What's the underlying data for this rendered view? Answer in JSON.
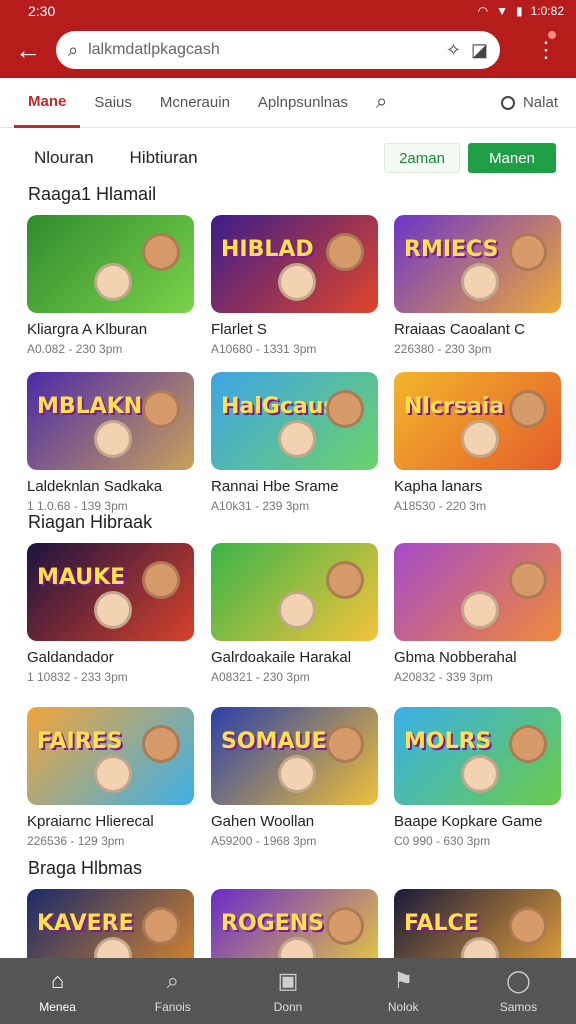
{
  "status": {
    "time": "2:30",
    "right": "1:0:82"
  },
  "search": {
    "value": "lalkmdatlpkagcash"
  },
  "tabs": [
    {
      "label": "Mane"
    },
    {
      "label": "Saius"
    },
    {
      "label": "Mcnerauin"
    },
    {
      "label": "Aplnpsunlnas"
    },
    {
      "label": "Nalat"
    }
  ],
  "filters": {
    "left1": "Nlouran",
    "left2": "Hibtiuran",
    "pill1": "2aman",
    "pill2": "Manen"
  },
  "sections": [
    {
      "title": "Raaga1 Hlamail"
    },
    {
      "title": "Riagan Hibraak"
    },
    {
      "title": "Braga Hlbmas"
    }
  ],
  "cards": [
    {
      "title": "Kliargra A Klburan",
      "meta": "A0.082 - 230 3pm",
      "colors": [
        "#2e8b2e",
        "#7bd34a"
      ]
    },
    {
      "title": "Flarlet S",
      "meta": "A10680 - 1331 3pm",
      "colors": [
        "#3a1d8a",
        "#e0452a"
      ]
    },
    {
      "title": "Rraiaas Caoalant C",
      "meta": "226380 - 230 3pm",
      "colors": [
        "#6a35c9",
        "#f0a93a"
      ]
    },
    {
      "title": "Laldeknlan Sadkaka",
      "meta": "1 1.0.68 - 139 3pm",
      "colors": [
        "#4b2aa8",
        "#c9a15c"
      ]
    },
    {
      "title": "Rannai Hbe Srame",
      "meta": "A10k31 - 239 3pm",
      "colors": [
        "#3fa4e6",
        "#6bd26a"
      ]
    },
    {
      "title": "Kapha lanars",
      "meta": "A18530 - 220 3m",
      "colors": [
        "#f2b52b",
        "#e55d2b"
      ]
    },
    {
      "title": "Galdandador",
      "meta": "1 10832 - 233 3pm",
      "colors": [
        "#1b1340",
        "#d9412a"
      ]
    },
    {
      "title": "Galrdoakaile Harakal",
      "meta": "A08321 - 230 3pm",
      "colors": [
        "#39b54a",
        "#f5c33a"
      ]
    },
    {
      "title": "Gbma Nobberahal",
      "meta": "A20832 - 339 3pm",
      "colors": [
        "#a54ac9",
        "#f08a3a"
      ]
    },
    {
      "title": "Kpraiarnc Hlierecal",
      "meta": "226536 - 129 3pm",
      "colors": [
        "#f2a43a",
        "#3db0e8"
      ]
    },
    {
      "title": "Gahen Woollan",
      "meta": "A59200 - 1968 3pm",
      "colors": [
        "#2a3fa8",
        "#f0c13a"
      ]
    },
    {
      "title": "Baape Kopkare Game",
      "meta": "C0 990 - 630 3pm",
      "colors": [
        "#3ab0e8",
        "#6acb4a"
      ]
    },
    {
      "title": "",
      "meta": "",
      "colors": [
        "#1b2a6a",
        "#e08a2a"
      ]
    },
    {
      "title": "",
      "meta": "",
      "colors": [
        "#6a2ac9",
        "#f0d33a"
      ]
    },
    {
      "title": "",
      "meta": "",
      "colors": [
        "#1a1a3a",
        "#f0a83a"
      ]
    }
  ],
  "thumb_logos": [
    "",
    "HIBLAD",
    "RMIECS",
    "MBLAKN",
    "HalGcaus",
    "Nlcrsaia",
    "MAUKE",
    "",
    "",
    "FAIRES",
    "SOMAUE",
    "MOLRS",
    "KAVERE",
    "ROGENS",
    "FALCE"
  ],
  "nav": [
    {
      "label": "Menea",
      "icon": "⌂"
    },
    {
      "label": "Fanois",
      "icon": "⌕"
    },
    {
      "label": "Donn",
      "icon": "▣"
    },
    {
      "label": "Nolok",
      "icon": "⚑"
    },
    {
      "label": "Samos",
      "icon": "◯"
    }
  ],
  "colors": {
    "accent": "#b71c1c",
    "green": "#1e9e45",
    "nav_bg": "#555555"
  }
}
